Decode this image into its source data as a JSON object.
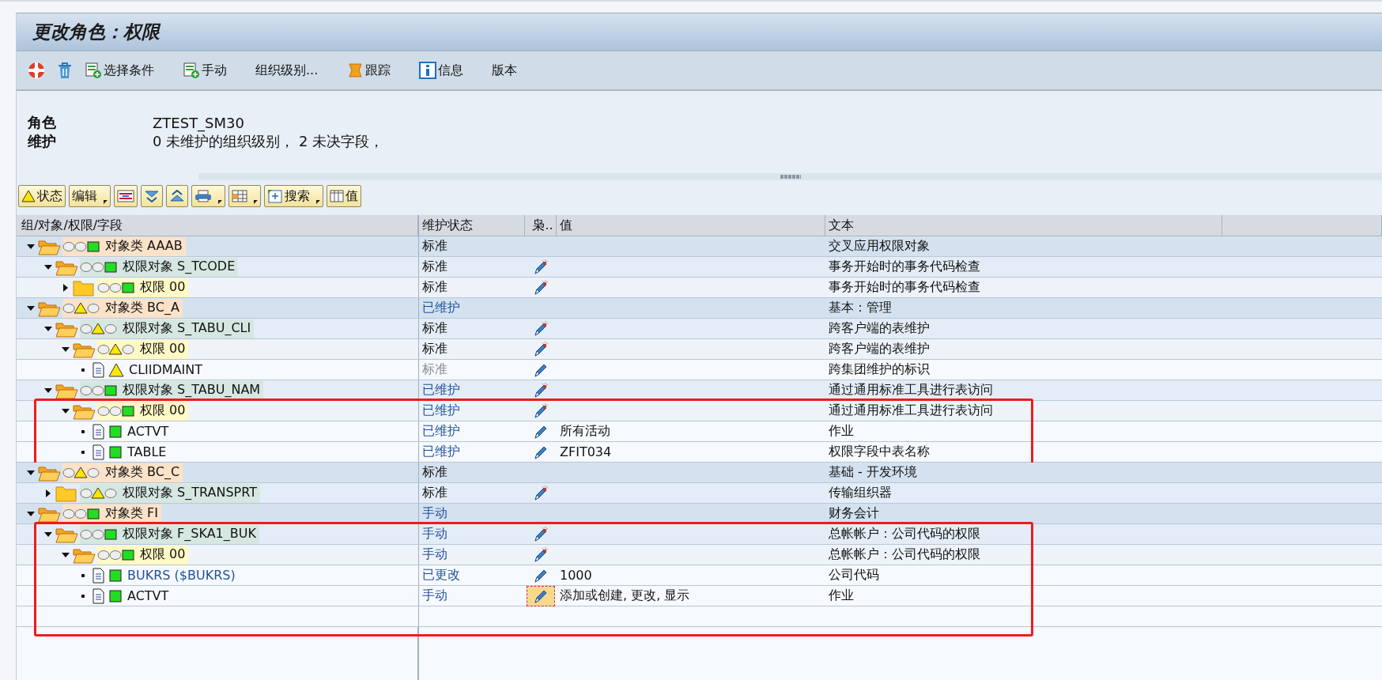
{
  "window": {
    "title": "更改角色：权限"
  },
  "app_toolbar": [
    {
      "kind": "generate"
    },
    {
      "kind": "delete"
    },
    {
      "kind": "selection",
      "label": "选择条件"
    },
    {
      "kind": "manual",
      "label": "手动"
    },
    {
      "kind": "plain",
      "label": "组织级别..."
    },
    {
      "kind": "trace",
      "label": "跟踪"
    },
    {
      "kind": "info",
      "label": "信息"
    },
    {
      "kind": "plain",
      "label": "版本"
    }
  ],
  "header": [
    {
      "label": "角色",
      "value": "ZTEST_SM30"
    },
    {
      "label": "维护",
      "value": "0 未维护的组织级别，  2 未决字段，"
    }
  ],
  "tree_toolbar": [
    {
      "kind": "status",
      "label": "状态",
      "dropdown": false
    },
    {
      "kind": "edit",
      "label": "编辑",
      "dropdown": true
    },
    {
      "kind": "layout",
      "dropdown": false
    },
    {
      "kind": "collapse",
      "dropdown": false
    },
    {
      "kind": "expand",
      "dropdown": false
    },
    {
      "kind": "print",
      "dropdown": true
    },
    {
      "kind": "grid",
      "dropdown": true
    },
    {
      "kind": "search",
      "label": "搜索",
      "dropdown": true
    },
    {
      "kind": "values",
      "label": "值",
      "dropdown": false
    }
  ],
  "columns": [
    "组/对象/权限/字段",
    "维护状态",
    "枭..",
    "值",
    "文本"
  ],
  "tree": [
    {
      "kind": "class",
      "label": "对象类 AAAB",
      "warning": false,
      "expanded": true,
      "status": "标准",
      "maintained": false,
      "greyed": false,
      "editable": false,
      "boxed": false,
      "text": "交叉应用权限对象",
      "children": [
        {
          "kind": "object",
          "label": "权限对象 S_TCODE",
          "warning": false,
          "expanded": true,
          "status": "标准",
          "maintained": false,
          "greyed": false,
          "editable": true,
          "wizard": true,
          "focused": false,
          "boxed": false,
          "text": "事务开始时的事务代码检查",
          "children": [
            {
              "kind": "auth",
              "label": "权限 00",
              "warning": false,
              "expanded": false,
              "status": "标准",
              "maintained": false,
              "greyed": false,
              "editable": true,
              "wizard": true,
              "focused": false,
              "boxed": false,
              "text": "事务开始时的事务代码检查"
            }
          ]
        }
      ]
    },
    {
      "kind": "class",
      "label": "对象类 BC_A",
      "warning": true,
      "expanded": true,
      "status": "已维护",
      "maintained": true,
      "greyed": false,
      "editable": false,
      "boxed": false,
      "text": "基本：管理",
      "children": [
        {
          "kind": "object",
          "label": "权限对象 S_TABU_CLI",
          "warning": true,
          "expanded": true,
          "status": "标准",
          "maintained": false,
          "greyed": false,
          "editable": true,
          "wizard": true,
          "focused": false,
          "boxed": false,
          "text": "跨客户端的表维护",
          "children": [
            {
              "kind": "auth",
              "label": "权限 00",
              "warning": true,
              "expanded": true,
              "status": "标准",
              "maintained": false,
              "greyed": false,
              "editable": true,
              "wizard": true,
              "focused": false,
              "boxed": false,
              "text": "跨客户端的表维护",
              "children": [
                {
                  "kind": "field",
                  "label": "CLIIDMAINT",
                  "warning": true,
                  "link": false,
                  "status": "标准",
                  "maintained": false,
                  "greyed": true,
                  "editable": true,
                  "wizard": false,
                  "focused": false,
                  "boxed": false,
                  "text": "跨集团维护的标识"
                }
              ]
            }
          ]
        },
        {
          "kind": "object",
          "label": "权限对象 S_TABU_NAM",
          "warning": false,
          "expanded": true,
          "status": "已维护",
          "maintained": true,
          "greyed": false,
          "editable": true,
          "wizard": true,
          "focused": false,
          "boxed": false,
          "text": "通过通用标准工具进行表访问",
          "children": [
            {
              "kind": "auth",
              "label": "权限 00",
              "warning": false,
              "expanded": true,
              "status": "已维护",
              "maintained": true,
              "greyed": false,
              "editable": true,
              "wizard": true,
              "focused": false,
              "boxed": true,
              "text": "通过通用标准工具进行表访问",
              "children": [
                {
                  "kind": "field",
                  "label": "ACTVT",
                  "warning": false,
                  "link": false,
                  "status": "已维护",
                  "maintained": true,
                  "greyed": false,
                  "editable": true,
                  "wizard": false,
                  "focused": false,
                  "boxed": true,
                  "value": "所有活动",
                  "text": "作业"
                },
                {
                  "kind": "field",
                  "label": "TABLE",
                  "warning": false,
                  "link": false,
                  "status": "已维护",
                  "maintained": true,
                  "greyed": false,
                  "editable": true,
                  "wizard": false,
                  "focused": false,
                  "boxed": true,
                  "value": "ZFIT034",
                  "text": "权限字段中表名称"
                }
              ]
            }
          ]
        }
      ]
    },
    {
      "kind": "class",
      "label": "对象类 BC_C",
      "warning": true,
      "expanded": true,
      "status": "标准",
      "maintained": false,
      "greyed": false,
      "editable": false,
      "boxed": false,
      "text": "基础 - 开发环境",
      "children": [
        {
          "kind": "object",
          "label": "权限对象 S_TRANSPRT",
          "warning": true,
          "expanded": false,
          "status": "标准",
          "maintained": false,
          "greyed": false,
          "editable": true,
          "wizard": true,
          "focused": false,
          "boxed": false,
          "text": "传输组织器"
        }
      ]
    },
    {
      "kind": "class",
      "label": "对象类 FI",
      "warning": false,
      "expanded": true,
      "status": "手动",
      "maintained": true,
      "greyed": false,
      "editable": false,
      "boxed": false,
      "text": "财务会计",
      "children": [
        {
          "kind": "object",
          "label": "权限对象 F_SKA1_BUK",
          "warning": false,
          "expanded": true,
          "status": "手动",
          "maintained": true,
          "greyed": false,
          "editable": true,
          "wizard": true,
          "focused": false,
          "boxed": true,
          "text": "总帐帐户：公司代码的权限",
          "children": [
            {
              "kind": "auth",
              "label": "权限 00",
              "warning": false,
              "expanded": true,
              "status": "手动",
              "maintained": true,
              "greyed": false,
              "editable": true,
              "wizard": true,
              "focused": false,
              "boxed": true,
              "text": "总帐帐户：公司代码的权限",
              "children": [
                {
                  "kind": "field",
                  "label": "BUKRS ($BUKRS)",
                  "warning": false,
                  "link": true,
                  "status": "已更改",
                  "maintained": true,
                  "greyed": false,
                  "editable": true,
                  "wizard": false,
                  "focused": false,
                  "boxed": true,
                  "value": "1000",
                  "text": "公司代码"
                },
                {
                  "kind": "field",
                  "label": "ACTVT",
                  "warning": false,
                  "link": false,
                  "status": "手动",
                  "maintained": true,
                  "greyed": false,
                  "editable": true,
                  "wizard": false,
                  "focused": true,
                  "boxed": true,
                  "value": "添加或创建, 更改, 显示",
                  "text": "作业"
                }
              ]
            }
          ]
        }
      ]
    }
  ]
}
